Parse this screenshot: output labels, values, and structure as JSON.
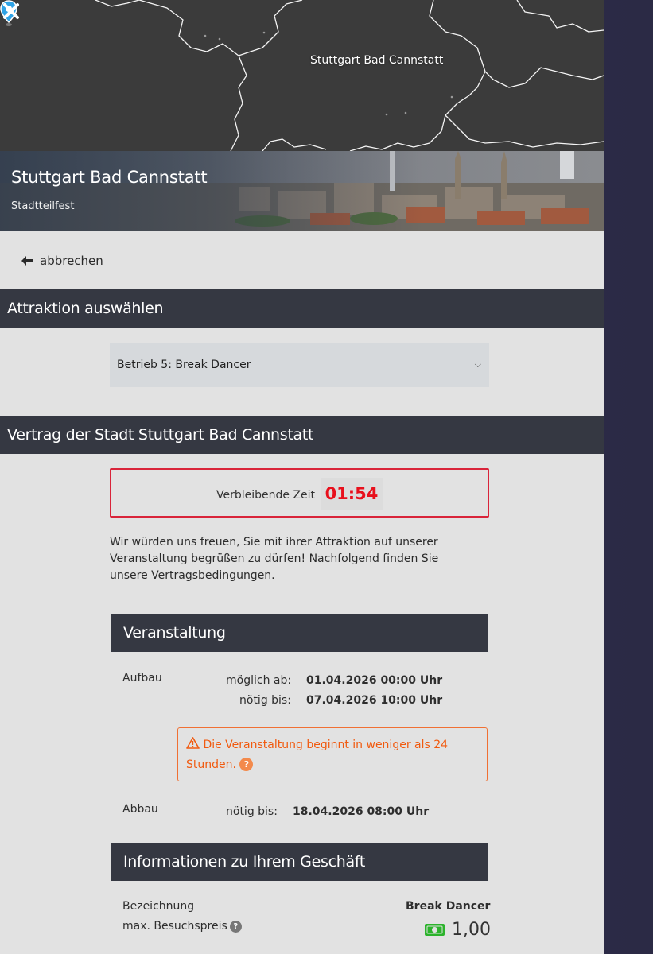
{
  "map": {
    "pin_label": "Stuttgart Bad Cannstatt"
  },
  "hero": {
    "title": "Stuttgart Bad Cannstatt",
    "subtitle": "Stadtteilfest"
  },
  "nav": {
    "back_label": "abbrechen"
  },
  "attraction_section": {
    "header": "Attraktion auswählen",
    "selected_option": "Betrieb 5: Break Dancer"
  },
  "contract_section": {
    "header": "Vertrag der Stadt Stuttgart Bad Cannstatt",
    "timer_label": "Verbleibende Zeit",
    "timer_value": "01:54",
    "intro": "Wir würden uns freuen, Sie mit ihrer Attraktion auf unserer Veranstaltung begrüßen zu dürfen! Nachfolgend finden Sie unsere Vertragsbedingungen."
  },
  "event": {
    "header": "Veranstaltung",
    "setup_label": "Aufbau",
    "setup_from_label": "möglich ab:",
    "setup_from_value": "01.04.2026 00:00 Uhr",
    "setup_until_label": "nötig bis:",
    "setup_until_value": "07.04.2026 10:00 Uhr",
    "warning": "Die Veranstaltung beginnt in weniger als 24 Stunden.",
    "teardown_label": "Abbau",
    "teardown_until_label": "nötig bis:",
    "teardown_until_value": "18.04.2026 08:00 Uhr"
  },
  "business": {
    "header": "Informationen zu Ihrem Geschäft",
    "name_label": "Bezeichnung",
    "name_value": "Break Dancer",
    "price_label": "max. Besuchspreis",
    "price_value": "1,00"
  },
  "colors": {
    "header_bg": "#353842",
    "timer_border": "#d9243a",
    "timer_text": "#e8101c",
    "warning": "#f15a0f",
    "money_icon": "#2bb32b"
  },
  "icons": [
    "close-icon",
    "map-pin-icon",
    "arrow-left-icon",
    "chevron-down-icon",
    "warning-triangle-icon",
    "question-icon",
    "money-icon"
  ]
}
